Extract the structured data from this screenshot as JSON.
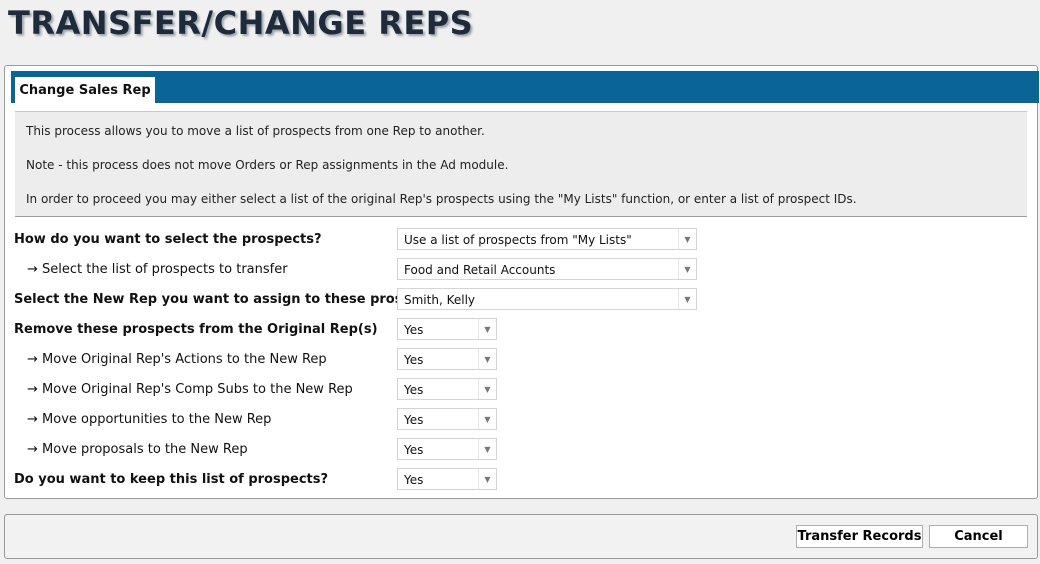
{
  "page": {
    "title": "TRANSFER/CHANGE REPS"
  },
  "tabs": [
    {
      "label": "Change Sales Rep"
    }
  ],
  "info": {
    "line1": "This process allows you to move a list of prospects from one Rep to another.",
    "line2": "Note - this process does not move Orders or Rep assignments in the Ad module.",
    "line3": "In order to proceed you may either select a list of the original Rep's prospects using the \"My Lists\" function, or enter a list of prospect IDs."
  },
  "form": {
    "select_method": {
      "label": "How do you want to select the prospects?",
      "value": "Use a list of prospects from \"My Lists\""
    },
    "select_list": {
      "label": "→ Select the list of prospects to transfer",
      "value": "Food and Retail Accounts"
    },
    "new_rep": {
      "label": "Select the New Rep you want to assign to these prospects",
      "value": "Smith, Kelly"
    },
    "remove_prospects": {
      "label": "Remove these prospects from the Original Rep(s)",
      "value": "Yes"
    },
    "move_actions": {
      "label": "→ Move Original Rep's Actions to the New Rep",
      "value": "Yes"
    },
    "move_comp_subs": {
      "label": "→ Move Original Rep's Comp Subs to the New Rep",
      "value": "Yes"
    },
    "move_opportunities": {
      "label": "→ Move opportunities to the New Rep",
      "value": "Yes"
    },
    "move_proposals": {
      "label": "→ Move proposals to the New Rep",
      "value": "Yes"
    },
    "keep_list": {
      "label": "Do you want to keep this list of prospects?",
      "value": "Yes"
    }
  },
  "footer": {
    "transfer_label": "Transfer Records",
    "cancel_label": "Cancel"
  }
}
